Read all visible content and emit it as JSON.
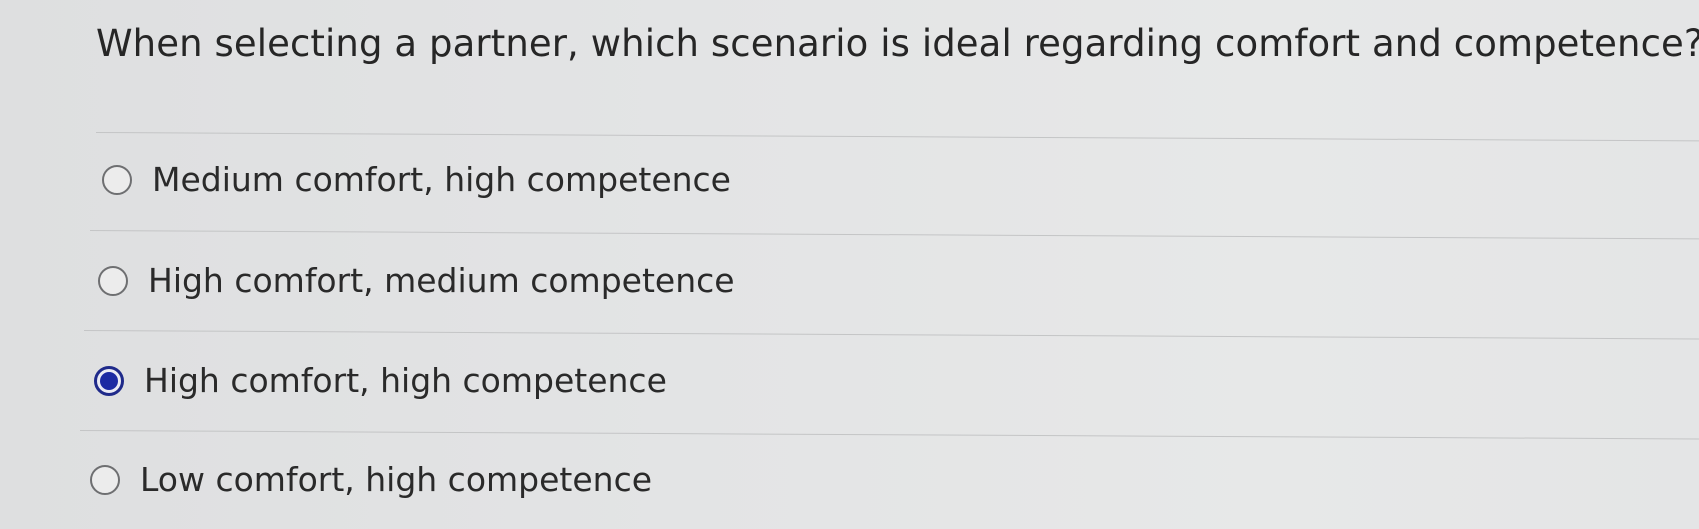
{
  "question": {
    "text": "When selecting a partner, which scenario is ideal regarding comfort and competence?"
  },
  "options": [
    {
      "label": "Medium comfort, high competence",
      "selected": false
    },
    {
      "label": "High comfort, medium competence",
      "selected": false
    },
    {
      "label": "High comfort, high competence",
      "selected": true
    },
    {
      "label": "Low comfort, high competence",
      "selected": false
    }
  ],
  "colors": {
    "background": "#e3e4e5",
    "radio_selected": "#1c2aa3",
    "divider": "#c4c5c6"
  }
}
